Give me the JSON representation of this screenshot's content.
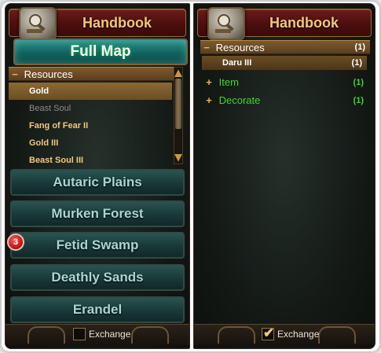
{
  "left_panel": {
    "title": "Handbook",
    "full_map_label": "Full Map",
    "resources": {
      "label": "Resources",
      "toggle": "−",
      "items": [
        {
          "label": "Gold",
          "state": "selected"
        },
        {
          "label": "Beast Soul",
          "state": "dim"
        },
        {
          "label": "Fang of Fear II",
          "state": "normal"
        },
        {
          "label": "Gold III",
          "state": "normal"
        },
        {
          "label": "Beast Soul III",
          "state": "normal"
        }
      ]
    },
    "regions": [
      {
        "label": "Autaric Plains"
      },
      {
        "label": "Murken Forest"
      },
      {
        "label": "Fetid Swamp",
        "badge": "3"
      },
      {
        "label": "Deathly Sands"
      },
      {
        "label": "Erandel"
      }
    ],
    "footer": {
      "checkbox_label": "Exchange",
      "checked": false
    }
  },
  "right_panel": {
    "title": "Handbook",
    "resources": {
      "label": "Resources",
      "toggle": "−",
      "count": "(1)"
    },
    "sub_items": [
      {
        "label": "Daru III",
        "count": "(1)"
      }
    ],
    "categories": [
      {
        "label": "Item",
        "toggle": "+",
        "count": "(1)"
      },
      {
        "label": "Decorate",
        "toggle": "+",
        "count": "(1)"
      }
    ],
    "footer": {
      "checkbox_label": "Exchange",
      "checked": true,
      "check_glyph": "✔"
    }
  },
  "colors": {
    "gold_text": "#f3c77d",
    "green_text": "#3fd62b",
    "teal_button": "#12625f",
    "header_red": "#4a0f0e"
  }
}
